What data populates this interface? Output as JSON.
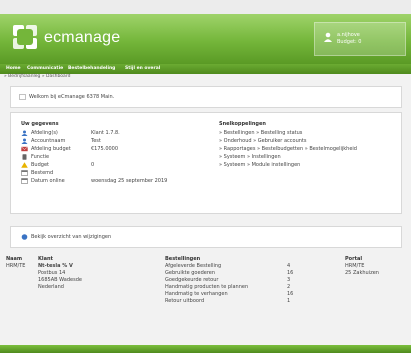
{
  "brand": {
    "name": "ecmanage"
  },
  "user": {
    "name": "a.nijhove",
    "budget": "Budget: 0"
  },
  "menu": [
    "Home",
    "Communicatie",
    "Bestelbehandeling",
    "Stijl en overal"
  ],
  "breadcrumb": "» Bedrijfsaanleg » Dashboard",
  "welcome": "Welkom bij eCmanage 6378 Main.",
  "account": {
    "title": "Uw gegevens",
    "rows": [
      {
        "icon": "user-icon",
        "label": "Afdeling(s)",
        "value": "Klant 1.7.8."
      },
      {
        "icon": "user-icon",
        "label": "Accountnaam",
        "value": "Test"
      },
      {
        "icon": "envelope-icon",
        "label": "Afdeling budget",
        "value": "€175.0000"
      },
      {
        "icon": "phone-icon",
        "label": "Functie",
        "value": ""
      },
      {
        "icon": "warning-icon",
        "label": "Budget",
        "value": "0"
      },
      {
        "icon": "calendar-icon",
        "label": "Bestemd",
        "value": ""
      },
      {
        "icon": "calendar-icon",
        "label": "Datum online",
        "value": "woensdag 25 september 2019"
      }
    ]
  },
  "shortcuts": {
    "title": "Snelkoppelingen",
    "items": [
      "» Bestellingen » Bestelling status",
      "» Onderhoud » Gebruiker accounts",
      "» Rapportages » Bestelbudgetten » Bestelmogelijkheid",
      "» Systeem » Instellingen",
      "» Systeem » Module instellingen"
    ]
  },
  "info": {
    "text": "Bekijk overzicht van wijzigingen"
  },
  "footer_info": {
    "col1": {
      "heading": "Naam",
      "value": "HRM/TE"
    },
    "col2": {
      "heading": "Klant",
      "lines": [
        "Nt-tesla % V",
        "Postbus 14",
        "1685AB Wadesde",
        "Nederland"
      ]
    },
    "orders": {
      "heading": "Bestellingen",
      "rows": [
        {
          "label": "Afgeleverde Bestelling",
          "value": "4"
        },
        {
          "label": "Gebruikte goederen",
          "value": "16"
        },
        {
          "label": "Goedgekeurde retour",
          "value": "3"
        },
        {
          "label": "Handmatig producten te plannen",
          "value": "2"
        },
        {
          "label": "Handmatig te verhangen",
          "value": "16"
        },
        {
          "label": "Retour uitboord",
          "value": "1"
        }
      ]
    },
    "portal": {
      "heading": "Portal",
      "lines": [
        "HRM/TE",
        "25 Zakhuizen"
      ]
    }
  }
}
